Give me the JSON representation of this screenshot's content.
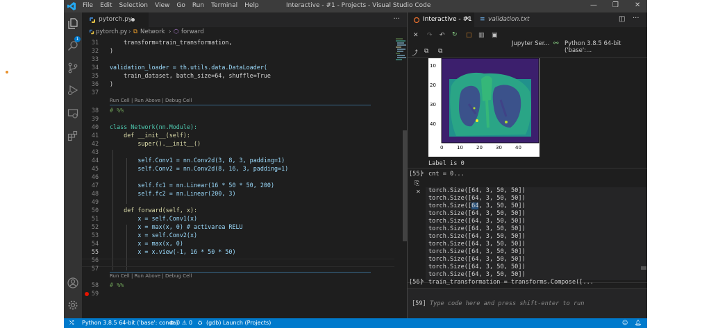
{
  "titlebar": {
    "menu": [
      "File",
      "Edit",
      "Selection",
      "View",
      "Go",
      "Run",
      "Terminal",
      "Help"
    ],
    "title": "Interactive - #1 - Projects - Visual Studio Code"
  },
  "activity_badge": "1",
  "editor": {
    "tab": "pytorch.py",
    "breadcrumb": [
      "pytorch.py",
      "Network",
      "forward"
    ],
    "codelens": "Run Cell | Run Above | Debug Cell",
    "lines": [
      {
        "n": "31",
        "text": "    transform=train_transformation,"
      },
      {
        "n": "32",
        "text": ")"
      },
      {
        "n": "33",
        "text": ""
      },
      {
        "n": "34",
        "text": "validation_loader = th.utils.data.DataLoader("
      },
      {
        "n": "35",
        "text": "    train_dataset, batch_size=64, shuffle=True"
      },
      {
        "n": "36",
        "text": ")"
      },
      {
        "n": "37",
        "text": ""
      },
      {
        "n": "38",
        "text": "# %%"
      },
      {
        "n": "39",
        "text": ""
      },
      {
        "n": "40",
        "text": "class Network(nn.Module):"
      },
      {
        "n": "41",
        "text": "    def __init__(self):"
      },
      {
        "n": "42",
        "text": "        super().__init__()"
      },
      {
        "n": "43",
        "text": ""
      },
      {
        "n": "44",
        "text": "        self.Conv1 = nn.Conv2d(3, 8, 3, padding=1)"
      },
      {
        "n": "45",
        "text": "        self.Conv2 = nn.Conv2d(8, 16, 3, padding=1)"
      },
      {
        "n": "46",
        "text": ""
      },
      {
        "n": "47",
        "text": "        self.fc1 = nn.Linear(16 * 50 * 50, 200)"
      },
      {
        "n": "48",
        "text": "        self.fc2 = nn.Linear(200, 3)"
      },
      {
        "n": "49",
        "text": ""
      },
      {
        "n": "50",
        "text": "    def forward(self, x):"
      },
      {
        "n": "51",
        "text": "        x = self.Conv1(x)"
      },
      {
        "n": "52",
        "text": "        x = max(x, 0) # activarea RELU"
      },
      {
        "n": "53",
        "text": "        x = self.Conv2(x)"
      },
      {
        "n": "54",
        "text": "        x = max(x, 0)"
      },
      {
        "n": "55",
        "text": "        x = x.view(-1, 16 * 50 * 50)"
      },
      {
        "n": "56",
        "text": ""
      },
      {
        "n": "57",
        "text": ""
      },
      {
        "n": "58",
        "text": "# %%"
      },
      {
        "n": "59",
        "text": ""
      }
    ]
  },
  "interactive": {
    "tab1": "Interactive - #1",
    "tab2": "validation.txt",
    "kernel_server": "Jupyter Ser...",
    "kernel": "Python 3.8.5 64-bit ('base':...",
    "plot_yticks": [
      "10",
      "20",
      "30",
      "40"
    ],
    "plot_xticks": [
      "0",
      "10",
      "20",
      "30",
      "40"
    ],
    "label_output": "Label is 0",
    "cell55_num": "[55]",
    "cell55_code": "cnt = 0...",
    "sizes": [
      "torch.Size([64, 3, 50, 50])",
      "torch.Size([64, 3, 50, 50])",
      "torch.Size([64, 3, 50, 50])",
      "torch.Size([64, 3, 50, 50])",
      "torch.Size([64, 3, 50, 50])",
      "torch.Size([64, 3, 50, 50])",
      "torch.Size([64, 3, 50, 50])",
      "torch.Size([64, 3, 50, 50])",
      "torch.Size([64, 3, 50, 50])",
      "torch.Size([64, 3, 50, 50])",
      "torch.Size([64, 3, 50, 50])",
      "torch.Size([64, 3, 50, 50])"
    ],
    "cell56_num": "[56]",
    "cell56_code": "train_transformation = transforms.Compose([...",
    "input_num": "[59]",
    "input_placeholder": "Type code here and press shift-enter to run"
  },
  "status": {
    "interpreter": "Python 3.8.5 64-bit ('base': conda)",
    "errors": "0",
    "warnings": "0",
    "launch": "(gdb) Launch (Projects)"
  },
  "colors": {
    "status_bar": "#007acc",
    "accent_highlight": "#264f78"
  }
}
